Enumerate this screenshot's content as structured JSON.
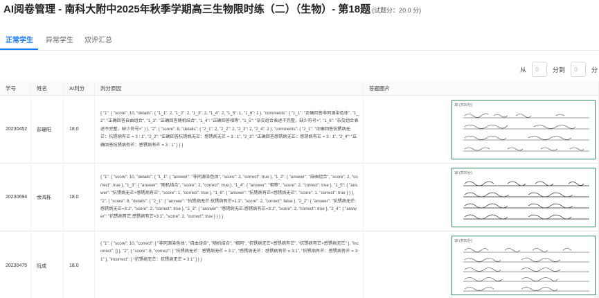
{
  "header": {
    "title": "AI阅卷管理 - 南科大附中2025年秋季学期高三生物限时练（二）（生物）- 第18题",
    "score_note": "(试题分：20.0 分)"
  },
  "tabs": [
    {
      "label": "正常学生",
      "active": true
    },
    {
      "label": "异常学生",
      "active": false
    },
    {
      "label": "双评汇总",
      "active": false
    }
  ],
  "filter": {
    "from_label": "从",
    "from_placeholder": "0",
    "to_label": "分到",
    "to_placeholder": "0",
    "unit_label": "分"
  },
  "table": {
    "columns": [
      "学号",
      "姓名",
      "AI判分",
      "判分原因",
      "答题图片"
    ],
    "rows": [
      {
        "student_id": "20230452",
        "name": "彭珊阳",
        "ai_score": "18.0",
        "reason": "{ \"1\": { \"score\": 10, \"details\": { \"1_1\": 2, \"1_2\": 2, \"1_3\": 2, \"1_4\": 2, \"1_5\": 1, \"1_6\": 1 }, \"comments\": { \"1_1\": \"正确回答非同源染色体\", \"1_2\": \"正确回答自由组合\", \"1_3\": \"正确回答随机结合\", \"1_4\": \"正确回答相等\", \"1_5\": \"杂交组合表述不完整，缺少符号×\", \"1_6\": \"杂交组合表述不完整，缺少符号×\" } }, \"2\": { \"score\": 8, \"details\": { \"2_1\": 2, \"2_2\": 2, \"2_3\": 2, \"2_4\": 2 }, \"comments\": { \"2_1\": \"正确回答抗锈病无芒：抗锈病有芒 = 3 : 1\", \"2_2\": \"正确回答抗锈病无芒：感锈病无芒 = 3 : 1\", \"2_3\": \"正确回答感锈病无芒：感锈病有芒 = 3 : 1\", \"2_4\": \"正确回答抗锈病有芒：感锈病有芒 = 3 : 1\" } } }"
      },
      {
        "student_id": "20230694",
        "name": "余鸿栎",
        "ai_score": "18.0",
        "reason": "{ \"1\": { \"score\": 10, \"details\": { \"1_1\": { \"answer\": \"非同源染色体\", \"score\": 2, \"correct\": true }, \"1_2\": { \"answer\": \"自由组合\", \"score\": 2, \"correct\": true }, \"1_3\": { \"answer\": \"随机结合\", \"score\": 2, \"correct\": true }, \"1_4\": { \"answer\": \"相等\", \"score\": 2, \"correct\": true }, \"1_5\": { \"answer\": \"抗锈病无芒×感锈病有芒\", \"score\": 1, \"correct\": true }, \"1_6\": { \"answer\": \"抗锈病有芒×感锈病无芒\", \"score\": 1, \"correct\": true } } }, \"2\": { \"score\": 8, \"details\": { \"2_1\": { \"answer\": \"抗锈病无芒:抗锈病有芒=1:3\", \"score\": 2, \"correct\": false }, \"2_2\": { \"answer\": \"抗锈病无芒:感锈病无芒=3:1\", \"score\": 2, \"correct\": true }, \"2_3\": { \"answer\": \"感锈病无芒:感锈病有芒=3:1\", \"score\": 2, \"correct\": true }, \"2_4\": { \"answer\": \"抗锈病有芒:感锈病有芒=3:1\", \"score\": 2, \"correct\": true } } } }"
      },
      {
        "student_id": "20230475",
        "name": "阮成",
        "ai_score": "18.0",
        "reason": "{ \"1\": { \"score\": 10, \"correct\": [ \"非同源染色体\", \"自由组合\", \"随机结合\", \"相同\", \"抗锈病无芒×感锈病有芒\", \"抗锈病有芒×感锈病无芒\" ], \"incorrect\": [] }, \"2\": { \"score\": 8, \"correct\": [ \"抗锈病无芒：感锈病无芒 = 3:1\", \"感锈病无芒：感锈病有芒 = 3:1\", \"抗锈病有芒：感锈病有芒 = 3:1\" ], \"incorrect\": [ \"抗锈病无芒：抗锈病无芒 = 3:1\" ] } }"
      }
    ]
  },
  "answer_image": {
    "header": "18 (共20分)"
  }
}
